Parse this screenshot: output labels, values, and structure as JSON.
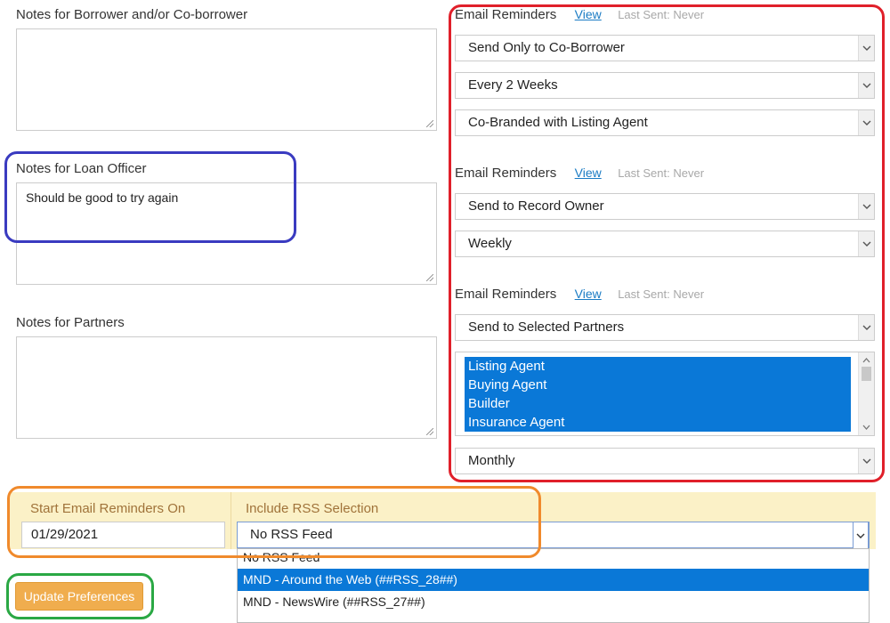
{
  "notes": {
    "borrower_label": "Notes for Borrower and/or Co-borrower",
    "borrower_value": "",
    "loan_officer_label": "Notes for Loan Officer",
    "loan_officer_value": "Should be good to try again",
    "partners_label": "Notes for Partners",
    "partners_value": ""
  },
  "reminders": [
    {
      "heading": "Email Reminders",
      "view_link": "View",
      "last_sent": "Last Sent: Never",
      "recipient": "Send Only to Co-Borrower",
      "frequency": "Every 2 Weeks",
      "branding": "Co-Branded with Listing Agent"
    },
    {
      "heading": "Email Reminders",
      "view_link": "View",
      "last_sent": "Last Sent: Never",
      "recipient": "Send to Record Owner",
      "frequency": "Weekly"
    },
    {
      "heading": "Email Reminders",
      "view_link": "View",
      "last_sent": "Last Sent: Never",
      "recipient": "Send to Selected Partners",
      "partners": [
        "Listing Agent",
        "Buying Agent",
        "Builder",
        "Insurance Agent"
      ],
      "frequency": "Monthly"
    }
  ],
  "schedule": {
    "start_label": "Start Email Reminders On",
    "start_date": "01/29/2021",
    "rss_label": "Include RSS Selection",
    "rss_selected": "No RSS Feed",
    "rss_options": [
      "No RSS Feed",
      "MND - Around the Web (##RSS_28##)",
      "MND - NewsWire (##RSS_27##)"
    ]
  },
  "update_button": "Update Preferences",
  "colors": {
    "highlight_red": "#e0202a",
    "highlight_blue": "#3a3bc0",
    "highlight_orange": "#f08a2c",
    "highlight_green": "#2aa844",
    "selection_blue": "#0a78d7",
    "button_orange": "#f0ad4e",
    "rss_bar": "#fbf1c7"
  }
}
